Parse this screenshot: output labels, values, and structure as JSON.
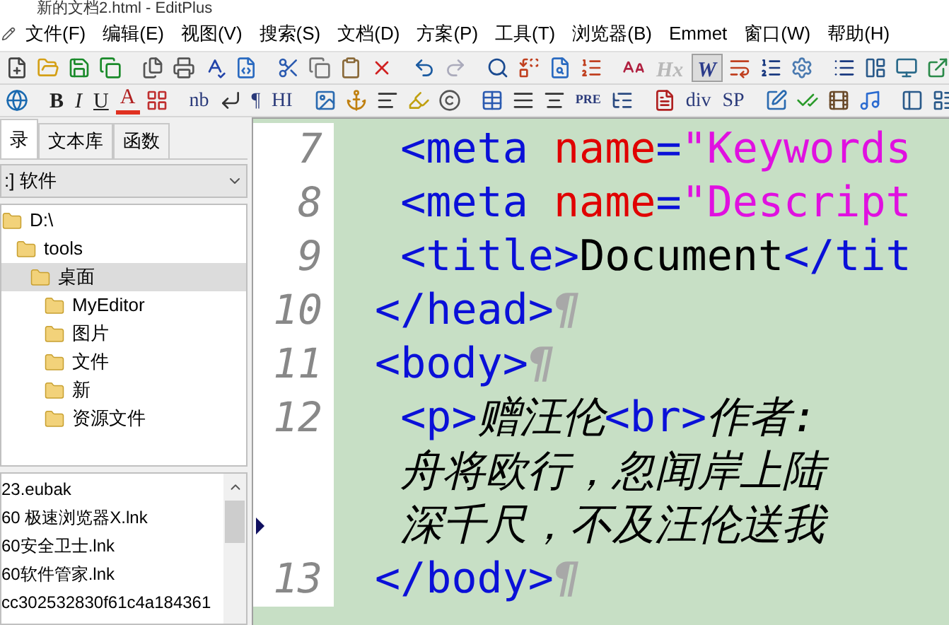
{
  "window": {
    "title": "新的文档2.html - EditPlus"
  },
  "menu": [
    "文件(F)",
    "编辑(E)",
    "视图(V)",
    "搜索(S)",
    "文档(D)",
    "方案(P)",
    "工具(T)",
    "浏览器(B)",
    "Emmet",
    "窗口(W)",
    "帮助(H)"
  ],
  "toolbar_1": [
    {
      "label": "Hx",
      "disabled": true,
      "selected": false
    },
    {
      "label": "W",
      "disabled": false,
      "selected": true
    }
  ],
  "toolbar_2": [
    {
      "label": "B",
      "kind": "bold"
    },
    {
      "label": "I",
      "kind": "italic"
    },
    {
      "label": "U",
      "kind": "underline"
    },
    {
      "label": "A",
      "kind": "color"
    },
    {
      "label": "nb",
      "kind": "plain"
    },
    {
      "label": "¶",
      "kind": "plain"
    },
    {
      "label": "HI",
      "kind": "plain"
    },
    {
      "label": "PRE",
      "kind": "small"
    },
    {
      "label": "div",
      "kind": "plain"
    },
    {
      "label": "SP",
      "kind": "plain"
    }
  ],
  "sidebar": {
    "tabs": [
      {
        "label": "录",
        "selected": true
      },
      {
        "label": "文本库",
        "selected": false
      },
      {
        "label": "函数",
        "selected": false
      }
    ],
    "drive": ":] 软件",
    "tree": [
      {
        "label": "D:\\",
        "selected": false,
        "children": [
          {
            "label": "tools",
            "selected": false,
            "children": [
              {
                "label": "桌面",
                "selected": true,
                "children": [
                  {
                    "label": "MyEditor",
                    "selected": false
                  },
                  {
                    "label": "图片",
                    "selected": false
                  },
                  {
                    "label": "文件",
                    "selected": false
                  },
                  {
                    "label": "新",
                    "selected": false
                  },
                  {
                    "label": "资源文件",
                    "selected": false
                  }
                ]
              }
            ]
          }
        ]
      }
    ],
    "files": [
      "23.eubak",
      "60 极速浏览器X.lnk",
      "60安全卫士.lnk",
      "60软件管家.lnk",
      "cc302532830f61c4a184361"
    ]
  },
  "editor": {
    "lines": [
      {
        "number": "7",
        "rows": [
          {
            "marker": false,
            "tokens": [
              {
                "kind": "tag",
                "text": "  <meta"
              },
              {
                "kind": "attr",
                "text": " name"
              },
              {
                "kind": "tag",
                "text": "="
              },
              {
                "kind": "value",
                "text": "\"Keywords"
              }
            ]
          }
        ]
      },
      {
        "number": "8",
        "rows": [
          {
            "marker": false,
            "tokens": [
              {
                "kind": "tag",
                "text": "  <meta"
              },
              {
                "kind": "attr",
                "text": " name"
              },
              {
                "kind": "tag",
                "text": "="
              },
              {
                "kind": "value",
                "text": "\"Descript"
              }
            ]
          }
        ]
      },
      {
        "number": "9",
        "rows": [
          {
            "marker": false,
            "tokens": [
              {
                "kind": "tag",
                "text": "  <title>"
              },
              {
                "kind": "text",
                "text": "Document"
              },
              {
                "kind": "tag",
                "text": "</tit"
              }
            ]
          }
        ]
      },
      {
        "number": "10",
        "rows": [
          {
            "marker": false,
            "tokens": [
              {
                "kind": "tag",
                "text": " </head>"
              },
              {
                "kind": "pilcrow",
                "text": "¶"
              }
            ]
          }
        ]
      },
      {
        "number": "11",
        "rows": [
          {
            "marker": false,
            "tokens": [
              {
                "kind": "tag",
                "text": " <body>"
              },
              {
                "kind": "pilcrow",
                "text": "¶"
              }
            ]
          }
        ]
      },
      {
        "number": "12",
        "rows": [
          {
            "marker": false,
            "tokens": [
              {
                "kind": "tag",
                "text": "  <p>"
              },
              {
                "kind": "cjk",
                "text": "赠汪伦"
              },
              {
                "kind": "tag",
                "text": "<br>"
              },
              {
                "kind": "cjk",
                "text": "作者:"
              }
            ]
          },
          {
            "marker": false,
            "tokens": [
              {
                "kind": "cjk",
                "text": "  舟将欧行，忽闻岸上陆"
              }
            ]
          },
          {
            "marker": true,
            "tokens": [
              {
                "kind": "cjk",
                "text": "  深千尺，不及汪伦送我"
              }
            ]
          }
        ]
      },
      {
        "number": "13",
        "rows": [
          {
            "marker": false,
            "tokens": [
              {
                "kind": "tag",
                "text": " </body>"
              },
              {
                "kind": "pilcrow",
                "text": "¶"
              }
            ]
          }
        ]
      }
    ]
  }
}
